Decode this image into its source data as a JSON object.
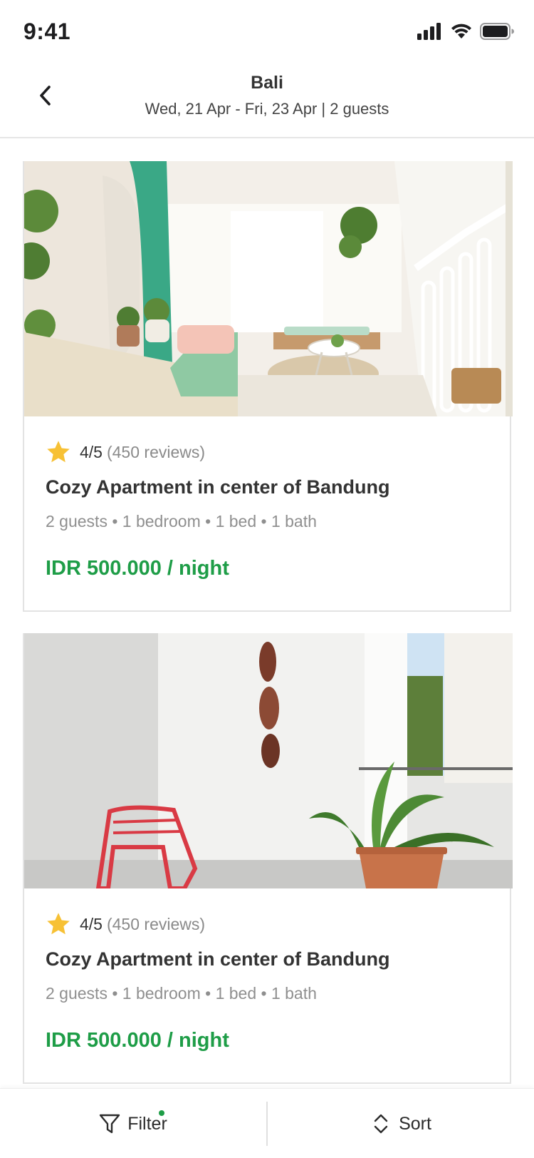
{
  "status_bar": {
    "time": "9:41",
    "icons": [
      "signal-icon",
      "wifi-icon",
      "battery-icon"
    ]
  },
  "header": {
    "title": "Bali",
    "subtitle": "Wed, 21 Apr - Fri, 23 Apr | 2 guests",
    "back_icon": "chevron-left-icon"
  },
  "listings": [
    {
      "photo": "living-room-photo",
      "rating": "4/5",
      "reviews": "(450 reviews)",
      "title": "Cozy Apartment in center of Bandung",
      "specs": "2 guests • 1 bedroom • 1 bed • 1 bath",
      "price": "IDR 500.000 / night"
    },
    {
      "photo": "balcony-photo",
      "rating": "4/5",
      "reviews": "(450 reviews)",
      "title": "Cozy Apartment in center of Bandung",
      "specs": "2 guests • 1 bedroom • 1 bed • 1 bath",
      "price": "IDR 500.000 / night"
    }
  ],
  "bottom_bar": {
    "filter_label": "Filter",
    "filter_active": true,
    "sort_label": "Sort"
  },
  "colors": {
    "accent_green": "#1e9d47",
    "star_yellow": "#f7c135",
    "muted_text": "#8f8f8f"
  }
}
